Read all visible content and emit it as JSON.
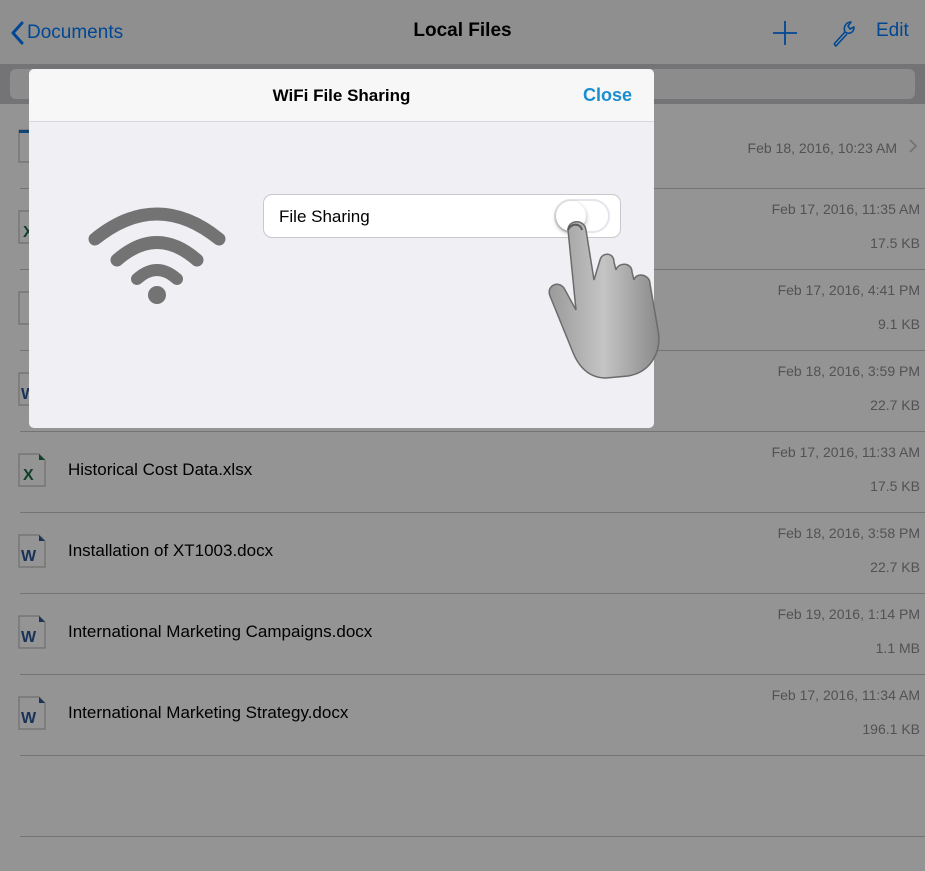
{
  "navbar": {
    "back_label": "Documents",
    "title": "Local Files",
    "edit_label": "Edit"
  },
  "files": [
    {
      "name": "",
      "type": "folder",
      "date": "Feb 18, 2016, 10:23 AM",
      "size": ""
    },
    {
      "name": "",
      "type": "xlsx",
      "date": "Feb 17, 2016, 11:35 AM",
      "size": "17.5 KB"
    },
    {
      "name": "",
      "type": "generic",
      "date": "Feb 17, 2016, 4:41 PM",
      "size": "9.1 KB"
    },
    {
      "name": "",
      "type": "docx",
      "date": "Feb 18, 2016, 3:59 PM",
      "size": "22.7 KB"
    },
    {
      "name": "Historical Cost Data.xlsx",
      "type": "xlsx",
      "date": "Feb 17, 2016, 11:33 AM",
      "size": "17.5 KB"
    },
    {
      "name": "Installation of XT1003.docx",
      "type": "docx",
      "date": "Feb 18, 2016, 3:58 PM",
      "size": "22.7 KB"
    },
    {
      "name": "International Marketing Campaigns.docx",
      "type": "docx",
      "date": "Feb 19, 2016, 1:14 PM",
      "size": "1.1 MB"
    },
    {
      "name": "International Marketing Strategy.docx",
      "type": "docx",
      "date": "Feb 17, 2016, 11:34 AM",
      "size": "196.1 KB"
    }
  ],
  "modal": {
    "title": "WiFi File Sharing",
    "close_label": "Close",
    "sharing_label": "File Sharing",
    "sharing_enabled": false
  },
  "colors": {
    "accent": "#007aff",
    "close": "#1a8fd0",
    "excel": "#1e7145",
    "word": "#2b579a",
    "wifi": "#737373"
  },
  "icons": [
    "chevron-left-icon",
    "plus-icon",
    "wrench-icon",
    "wifi-icon",
    "hand-pointer-icon",
    "excel-file-icon",
    "word-file-icon",
    "chevron-right-icon"
  ]
}
